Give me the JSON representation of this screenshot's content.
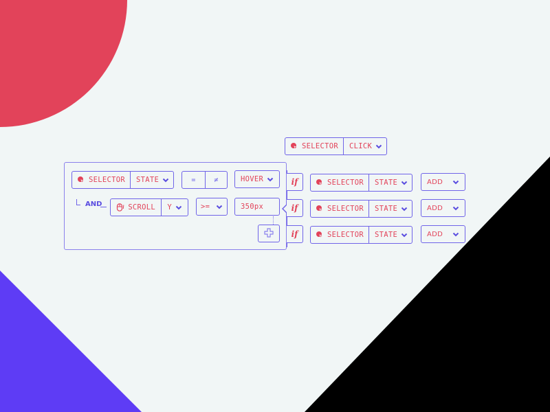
{
  "colors": {
    "accent_purple": "#6f63e8",
    "accent_red": "#e2435a",
    "background": "#f1f6f6",
    "black": "#000000",
    "violet_shape": "#5e3cf5"
  },
  "top_trigger": {
    "target_label": "SELECTOR",
    "target_icon": "selector-cursor-icon",
    "event_value": "CLICK"
  },
  "condition_panel": {
    "row1": {
      "target_label": "SELECTOR",
      "target_icon": "selector-cursor-icon",
      "property_value": "STATE",
      "operator_equal": "=",
      "operator_not_equal": "≠",
      "value": "HOVER"
    },
    "connector": "AND",
    "row2": {
      "target_label": "SCROLL",
      "target_icon": "mouse-scroll-icon",
      "axis_value": "Y",
      "operator_value": ">=",
      "value_input": "350px"
    },
    "add_condition_icon": "plus-icon"
  },
  "rules": [
    {
      "if_label": "if",
      "target_label": "SELECTOR",
      "property_value": "STATE",
      "action_value": "ADD"
    },
    {
      "if_label": "if",
      "target_label": "SELECTOR",
      "property_value": "STATE",
      "action_value": "ADD"
    },
    {
      "if_label": "if",
      "target_label": "SELECTOR",
      "property_value": "STATE",
      "action_value": "ADD"
    }
  ]
}
